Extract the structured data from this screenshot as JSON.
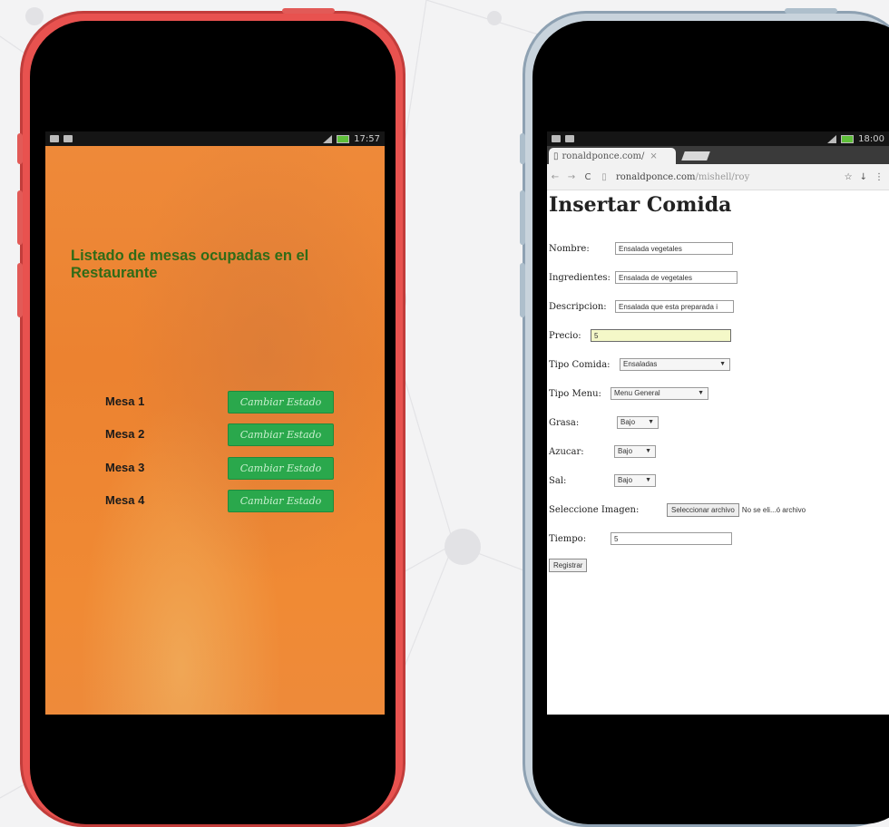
{
  "left_phone": {
    "statusbar": {
      "left_text": "⇄ ▭",
      "right_text": "17:57"
    },
    "title": "Listado de mesas ocupadas en el Restaurante",
    "mesas": [
      {
        "label": "Mesa 1",
        "button": "Cambiar Estado"
      },
      {
        "label": "Mesa 2",
        "button": "Cambiar Estado"
      },
      {
        "label": "Mesa 3",
        "button": "Cambiar Estado"
      },
      {
        "label": "Mesa 4",
        "button": "Cambiar Estado"
      }
    ]
  },
  "right_phone": {
    "statusbar": {
      "left_text": "⇄ ▭",
      "right_text": "18:00"
    },
    "tab": {
      "title": "ronaldponce.com/",
      "close": "×"
    },
    "urlbar": {
      "host": "ronaldponce.com",
      "path": "/mishell/roy"
    },
    "form": {
      "heading": "Insertar Comida",
      "nombre": {
        "label": "Nombre:",
        "value": "Ensalada vegetales"
      },
      "ingredientes": {
        "label": "Ingredientes:",
        "value": "Ensalada de vegetales"
      },
      "descripcion": {
        "label": "Descripcion:",
        "value": "Ensalada que esta preparada i"
      },
      "precio": {
        "label": "Precio:",
        "value": "5"
      },
      "tipo_comida": {
        "label": "Tipo Comida:",
        "value": "Ensaladas"
      },
      "tipo_menu": {
        "label": "Tipo Menu:",
        "value": "Menu General"
      },
      "grasa": {
        "label": "Grasa:",
        "value": "Bajo"
      },
      "azucar": {
        "label": "Azucar:",
        "value": "Bajo"
      },
      "sal": {
        "label": "Sal:",
        "value": "Bajo"
      },
      "imagen": {
        "label": "Seleccione Imagen:",
        "button": "Seleccionar archivo",
        "note": "No se eli...ó archivo"
      },
      "tiempo": {
        "label": "Tiempo:",
        "value": "5"
      },
      "submit": "Registrar"
    }
  },
  "colors": {
    "left_phone_frame": "#e8524f",
    "right_phone_frame": "#c8d3dc",
    "left_screen_bg": "#ee8a3a",
    "title_green": "#2f6b17",
    "button_green": "#2aa84c",
    "precio_highlight": "#f4f8c8"
  }
}
